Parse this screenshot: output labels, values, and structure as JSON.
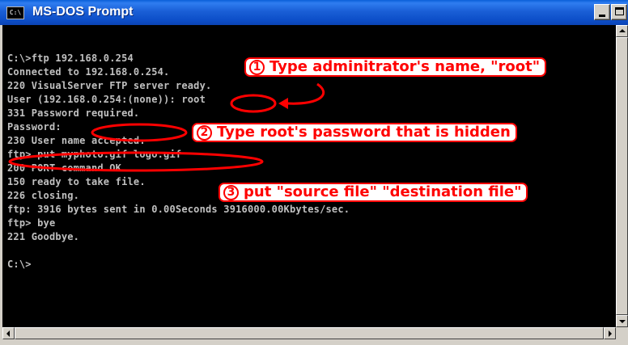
{
  "window": {
    "title": "MS-DOS Prompt",
    "icon_text": "C:\\"
  },
  "console": {
    "lines": [
      "C:\\>ftp 192.168.0.254",
      "Connected to 192.168.0.254.",
      "220 VisualServer FTP server ready.",
      "User (192.168.0.254:(none)): root",
      "331 Password required.",
      "Password:",
      "230 User name accepted.",
      "ftp> put myphoto.gif logo.gif",
      "200 PORT command OK.",
      "150 ready to take file.",
      "226 closing.",
      "ftp: 3916 bytes sent in 0.00Seconds 3916000.00Kbytes/sec.",
      "ftp> bye",
      "221 Goodbye.",
      "",
      "C:\\>"
    ]
  },
  "annotations": [
    {
      "number": "1",
      "text": "Type adminitrator's name, \"root\""
    },
    {
      "number": "2",
      "text": "Type root's password that is hidden"
    },
    {
      "number": "3",
      "text": "put \"source file\" \"destination file\""
    }
  ],
  "colors": {
    "annotation": "#ff0000",
    "console_background": "#000000",
    "console_text": "#c0c0c0",
    "titlebar": "#0c4ec8"
  }
}
